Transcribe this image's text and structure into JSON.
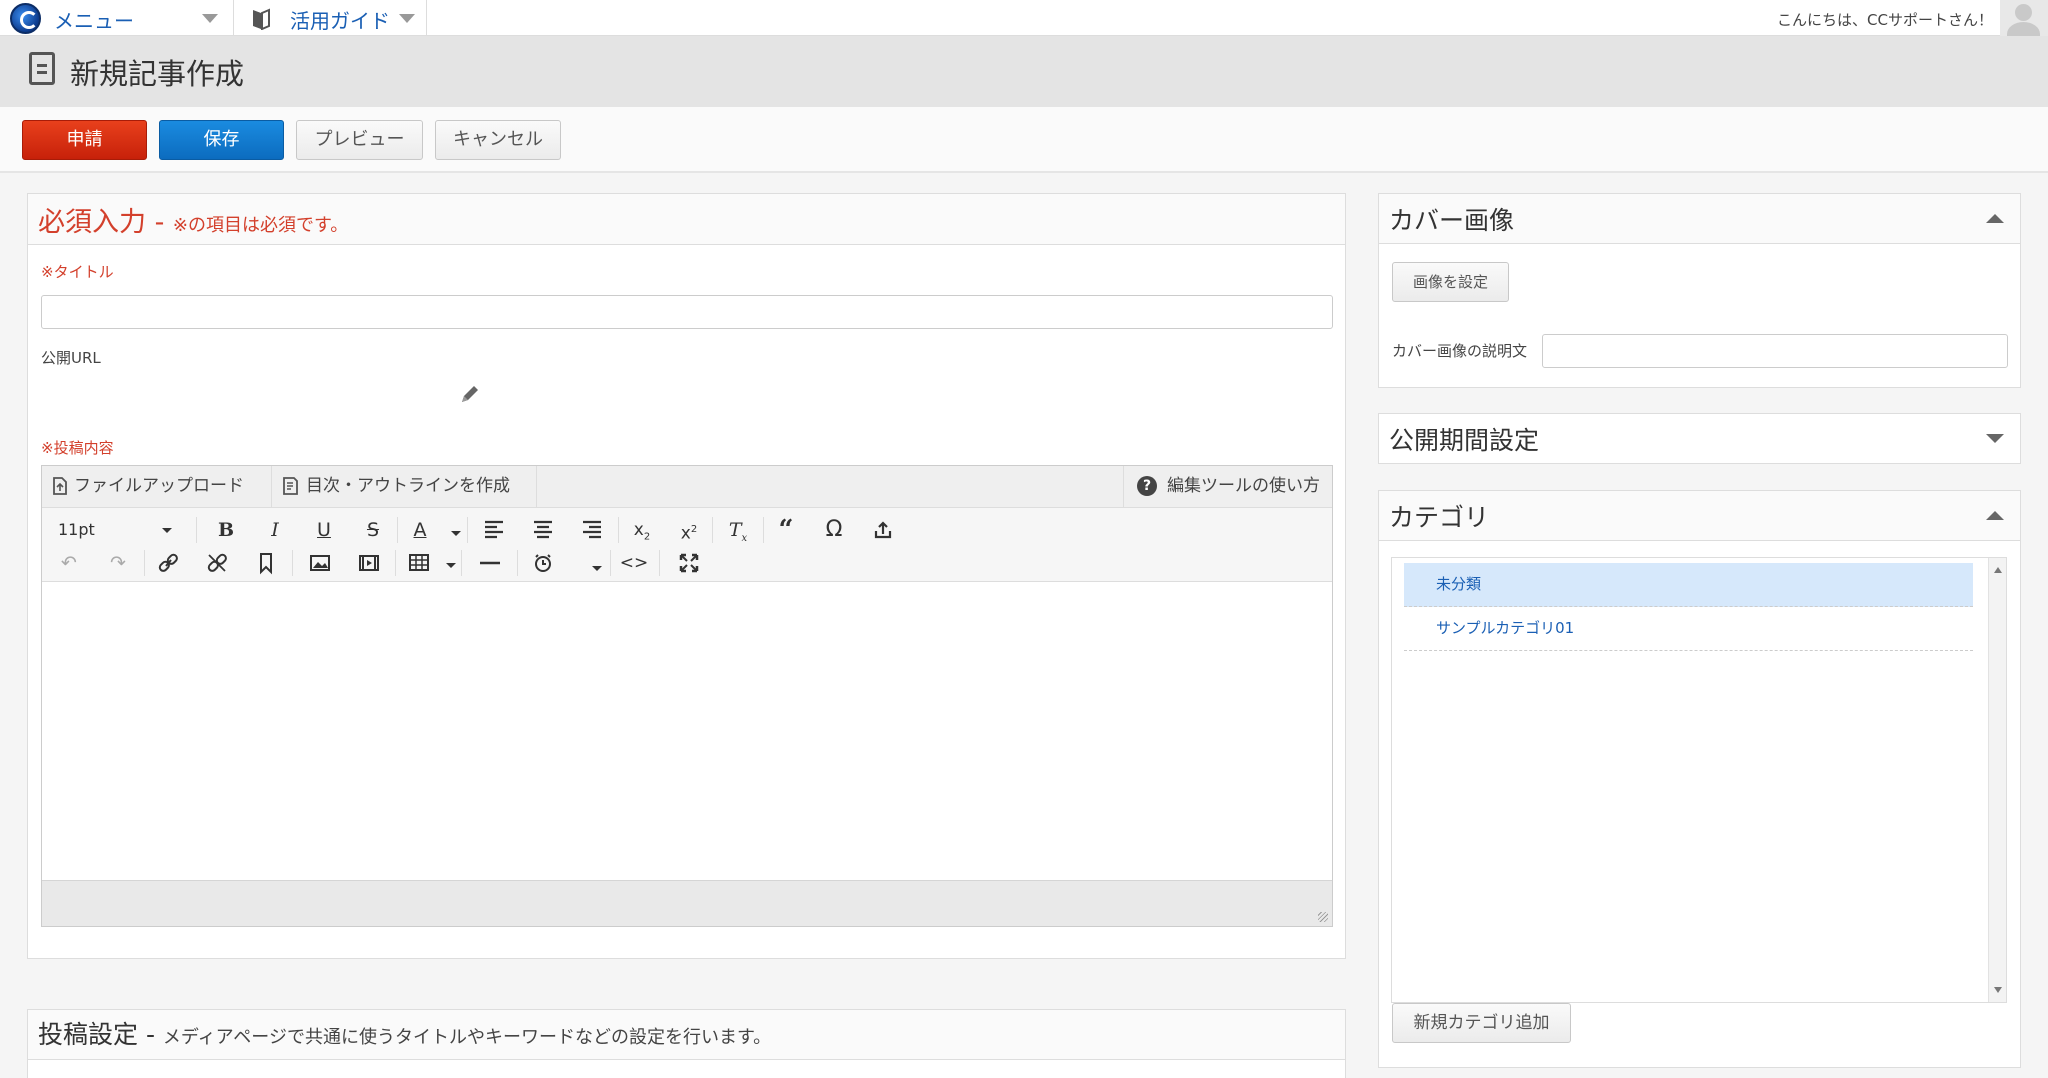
{
  "topbar": {
    "menu_label": "メニュー",
    "guide_label": "活用ガイド",
    "greeting": "こんにちは、CCサポートさん！"
  },
  "page": {
    "title": "新規記事作成"
  },
  "actions": {
    "apply": "申請",
    "save": "保存",
    "preview": "プレビュー",
    "cancel": "キャンセル"
  },
  "required": {
    "heading": "必須入力 -",
    "note": "※の項目は必須です。",
    "title_label": "※タイトル",
    "title_value": "",
    "url_label": "公開URL",
    "content_label": "※投稿内容"
  },
  "editor": {
    "tab_upload": "ファイルアップロード",
    "tab_outline": "目次・アウトラインを作成",
    "help": "編集ツールの使い方",
    "help_mark": "?",
    "font_size": "11pt",
    "body_text": ""
  },
  "sidebar": {
    "cover": {
      "title": "カバー画像",
      "set_button": "画像を設定",
      "desc_label": "カバー画像の説明文",
      "desc_value": ""
    },
    "period": {
      "title": "公開期間設定"
    },
    "category": {
      "title": "カテゴリ",
      "items": [
        {
          "label": "未分類",
          "selected": true
        },
        {
          "label": "サンプルカテゴリ01",
          "selected": false
        }
      ],
      "add_button": "新規カテゴリ追加"
    }
  },
  "post_settings": {
    "heading": "投稿設定 -",
    "note": "メディアページで共通に使うタイトルやキーワードなどの設定を行います。"
  },
  "colors": {
    "required_red": "#d3402c",
    "apply_button": "#d7300f",
    "save_button": "#127bd0",
    "link_blue": "#1a5fb4",
    "selected_category": "#d6e8fb"
  }
}
